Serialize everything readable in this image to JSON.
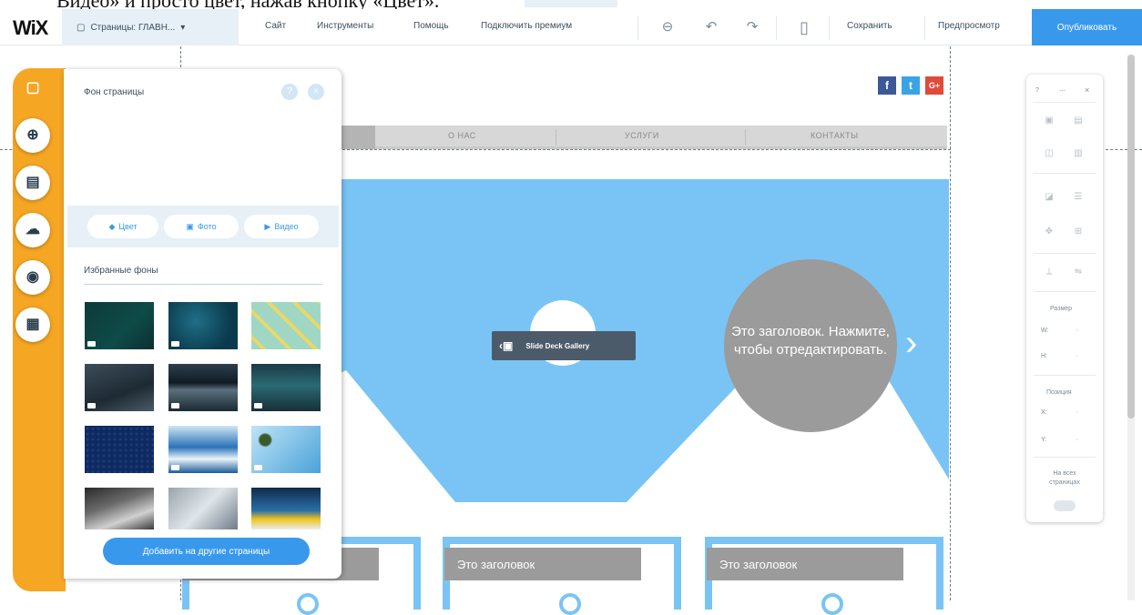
{
  "caption": "Видео» и просто цвет, нажав кнопку «Цвет».",
  "topbar": {
    "logo": "WiX",
    "pages_label": "Страницы: ГЛАВН...",
    "menu": [
      "Сайт",
      "Инструменты",
      "Помощь",
      "Подключить премиум"
    ],
    "save_label": "Сохранить",
    "preview_label": "Предпросмотр",
    "publish_label": "Опубликовать"
  },
  "panel": {
    "title": "Фон страницы",
    "help": "?",
    "close": "×",
    "buttons": [
      "Цвет",
      "Фото",
      "Видео"
    ],
    "favorites_label": "Избранные фоны",
    "add_button": "Добавить на другие страницы"
  },
  "site": {
    "nav": [
      "О НАС",
      "УСЛУГИ",
      "КОНТАКТЫ"
    ],
    "hero_text": "Это заголовок. Нажмите, чтобы отредактировать.",
    "gallery_label": "Slide Deck Gallery",
    "card_headings": [
      "Это заголовок",
      "Это заголовок"
    ],
    "social": [
      "f",
      "t",
      "G+"
    ]
  },
  "tools": {
    "size_label": "Размер",
    "w": "W:",
    "h": "H:",
    "position_label": "Позиция",
    "x": "X:",
    "y": "Y:",
    "all_pages_label": "На всех страницах",
    "top_icons": [
      "?",
      "⋯",
      "×"
    ]
  },
  "colors": {
    "accent": "#3899ec",
    "rail": "#f5a623",
    "hero": "#79c4f5",
    "gray": "#9b9b9b"
  }
}
